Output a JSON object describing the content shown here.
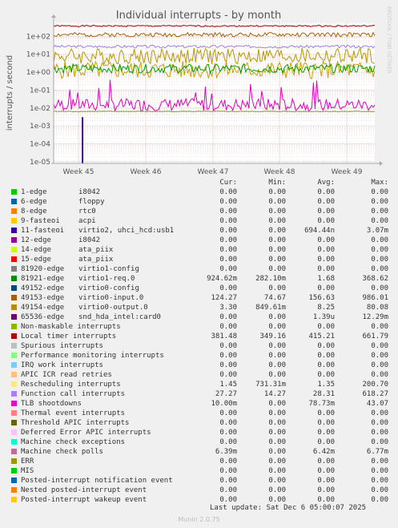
{
  "chart_data": {
    "type": "line",
    "title": "Individual interrupts - by month",
    "ylabel": "interrupts / second",
    "yscale": "log",
    "ylim": [
      8e-06,
      600
    ],
    "y_ticks": [
      "1e-05",
      "1e-04",
      "1e-03",
      "1e-02",
      "1e-01",
      "1e+00",
      "1e+01",
      "1e+02"
    ],
    "y_tick_values": [
      1e-05,
      0.0001,
      0.001,
      0.01,
      0.1,
      1,
      10,
      100
    ],
    "x_ticks": [
      "Week 45",
      "Week 46",
      "Week 47",
      "Week 48",
      "Week 49"
    ],
    "watermark": "RRDTOOL / TOBI OETIKER",
    "grid": true,
    "series": [
      {
        "name": "Local timer interrupts",
        "color": "#8b0000",
        "level": 380,
        "spread": 0.04,
        "seed": 1
      },
      {
        "name": "virtio0-input.0",
        "color": "#b05a00",
        "level": 124,
        "spread": 0.12,
        "seed": 2
      },
      {
        "name": "Function call interrupts",
        "color": "#9b7fe0",
        "level": 27,
        "spread": 0.08,
        "seed": 3
      },
      {
        "name": "virtio0-output.0",
        "color": "#b89800",
        "level": 8,
        "spread": 0.45,
        "seed": 4
      },
      {
        "name": "Rescheduling interrupts",
        "color": "#c8a200",
        "level": 1.35,
        "spread": 0.5,
        "seed": 5
      },
      {
        "name": "virtio1-req.0",
        "color": "#00a000",
        "level": 1.6,
        "spread": 0.25,
        "seed": 6
      },
      {
        "name": "TLB shootdowns",
        "color": "#e000c0",
        "level": 0.015,
        "spread": 0.35,
        "seed": 7,
        "spikes": true
      },
      {
        "name": "Machine check polls",
        "color": "#7fa020",
        "level": 0.00642,
        "spread": 0.02,
        "seed": 8
      },
      {
        "name": "11-fasteoi",
        "color": "#4b0082",
        "level": 0,
        "spread": 0,
        "seed": 9,
        "single_spike": 0.00307
      }
    ]
  },
  "legend_header": {
    "cur": "Cur:",
    "min": "Min:",
    "avg": "Avg:",
    "max": "Max:"
  },
  "legend": [
    {
      "name": "1-edge",
      "desc": "i8042",
      "color": "#00cc00",
      "cur": "0.00",
      "min": "0.00",
      "avg": "0.00",
      "max": "0.00"
    },
    {
      "name": "6-edge",
      "desc": "floppy",
      "color": "#0066b3",
      "cur": "0.00",
      "min": "0.00",
      "avg": "0.00",
      "max": "0.00"
    },
    {
      "name": "8-edge",
      "desc": "rtc0",
      "color": "#ff8000",
      "cur": "0.00",
      "min": "0.00",
      "avg": "0.00",
      "max": "0.00"
    },
    {
      "name": "9-fasteoi",
      "desc": "acpi",
      "color": "#ffcc00",
      "cur": "0.00",
      "min": "0.00",
      "avg": "0.00",
      "max": "0.00"
    },
    {
      "name": "11-fasteoi",
      "desc": "virtio2, uhci_hcd:usb1",
      "color": "#330099",
      "cur": "0.00",
      "min": "0.00",
      "avg": "694.44n",
      "max": "3.07m"
    },
    {
      "name": "12-edge",
      "desc": "i8042",
      "color": "#990099",
      "cur": "0.00",
      "min": "0.00",
      "avg": "0.00",
      "max": "0.00"
    },
    {
      "name": "14-edge",
      "desc": "ata_piix",
      "color": "#ccff00",
      "cur": "0.00",
      "min": "0.00",
      "avg": "0.00",
      "max": "0.00"
    },
    {
      "name": "15-edge",
      "desc": "ata_piix",
      "color": "#ff0000",
      "cur": "0.00",
      "min": "0.00",
      "avg": "0.00",
      "max": "0.00"
    },
    {
      "name": "81920-edge",
      "desc": "virtio1-config",
      "color": "#808080",
      "cur": "0.00",
      "min": "0.00",
      "avg": "0.00",
      "max": "0.00"
    },
    {
      "name": "81921-edge",
      "desc": "virtio1-req.0",
      "color": "#008f00",
      "cur": "924.62m",
      "min": "282.10m",
      "avg": "1.68",
      "max": "368.62"
    },
    {
      "name": "49152-edge",
      "desc": "virtio0-config",
      "color": "#00487d",
      "cur": "0.00",
      "min": "0.00",
      "avg": "0.00",
      "max": "0.00"
    },
    {
      "name": "49153-edge",
      "desc": "virtio0-input.0",
      "color": "#b35a00",
      "cur": "124.27",
      "min": "74.67",
      "avg": "156.63",
      "max": "986.01"
    },
    {
      "name": "49154-edge",
      "desc": "virtio0-output.0",
      "color": "#b38f00",
      "cur": "3.30",
      "min": "849.61m",
      "avg": "8.25",
      "max": "80.08"
    },
    {
      "name": "65536-edge",
      "desc": "snd_hda_intel:card0",
      "color": "#6b006b",
      "cur": "0.00",
      "min": "0.00",
      "avg": "1.39u",
      "max": "12.29m"
    },
    {
      "name": "Non-maskable interrupts",
      "desc": "",
      "color": "#8fb300",
      "cur": "0.00",
      "min": "0.00",
      "avg": "0.00",
      "max": "0.00"
    },
    {
      "name": "Local timer interrupts",
      "desc": "",
      "color": "#b30000",
      "cur": "381.48",
      "min": "349.16",
      "avg": "415.21",
      "max": "661.79"
    },
    {
      "name": "Spurious interrupts",
      "desc": "",
      "color": "#bebebe",
      "cur": "0.00",
      "min": "0.00",
      "avg": "0.00",
      "max": "0.00"
    },
    {
      "name": "Performance monitoring interrupts",
      "desc": "",
      "color": "#80ff80",
      "cur": "0.00",
      "min": "0.00",
      "avg": "0.00",
      "max": "0.00"
    },
    {
      "name": "IRQ work interrupts",
      "desc": "",
      "color": "#80c9ff",
      "cur": "0.00",
      "min": "0.00",
      "avg": "0.00",
      "max": "0.00"
    },
    {
      "name": "APIC ICR read retries",
      "desc": "",
      "color": "#ffc080",
      "cur": "0.00",
      "min": "0.00",
      "avg": "0.00",
      "max": "0.00"
    },
    {
      "name": "Rescheduling interrupts",
      "desc": "",
      "color": "#ffe680",
      "cur": "1.45",
      "min": "731.31m",
      "avg": "1.35",
      "max": "200.70"
    },
    {
      "name": "Function call interrupts",
      "desc": "",
      "color": "#aa80ff",
      "cur": "27.27",
      "min": "14.27",
      "avg": "28.31",
      "max": "618.27"
    },
    {
      "name": "TLB shootdowns",
      "desc": "",
      "color": "#ee00cc",
      "cur": "10.00m",
      "min": "0.00",
      "avg": "78.73m",
      "max": "43.07"
    },
    {
      "name": "Thermal event interrupts",
      "desc": "",
      "color": "#ff8080",
      "cur": "0.00",
      "min": "0.00",
      "avg": "0.00",
      "max": "0.00"
    },
    {
      "name": "Threshold APIC interrupts",
      "desc": "",
      "color": "#666600",
      "cur": "0.00",
      "min": "0.00",
      "avg": "0.00",
      "max": "0.00"
    },
    {
      "name": "Deferred Error APIC interrupts",
      "desc": "",
      "color": "#ffbfff",
      "cur": "0.00",
      "min": "0.00",
      "avg": "0.00",
      "max": "0.00"
    },
    {
      "name": "Machine check exceptions",
      "desc": "",
      "color": "#00ffcc",
      "cur": "0.00",
      "min": "0.00",
      "avg": "0.00",
      "max": "0.00"
    },
    {
      "name": "Machine check polls",
      "desc": "",
      "color": "#cc6699",
      "cur": "6.39m",
      "min": "0.00",
      "avg": "6.42m",
      "max": "6.77m"
    },
    {
      "name": "ERR",
      "desc": "",
      "color": "#999900",
      "cur": "0.00",
      "min": "0.00",
      "avg": "0.00",
      "max": "0.00"
    },
    {
      "name": "MIS",
      "desc": "",
      "color": "#00cc00",
      "cur": "0.00",
      "min": "0.00",
      "avg": "0.00",
      "max": "0.00"
    },
    {
      "name": "Posted-interrupt notification event",
      "desc": "",
      "color": "#0066b3",
      "cur": "0.00",
      "min": "0.00",
      "avg": "0.00",
      "max": "0.00"
    },
    {
      "name": "Nested posted-interrupt event",
      "desc": "",
      "color": "#ff8000",
      "cur": "0.00",
      "min": "0.00",
      "avg": "0.00",
      "max": "0.00"
    },
    {
      "name": "Posted-interrupt wakeup event",
      "desc": "",
      "color": "#ffcc00",
      "cur": "0.00",
      "min": "0.00",
      "avg": "0.00",
      "max": "0.00"
    }
  ],
  "last_update": "Last update: Sat Dec  6 05:00:07 2025",
  "version": "Munin 2.0.75"
}
